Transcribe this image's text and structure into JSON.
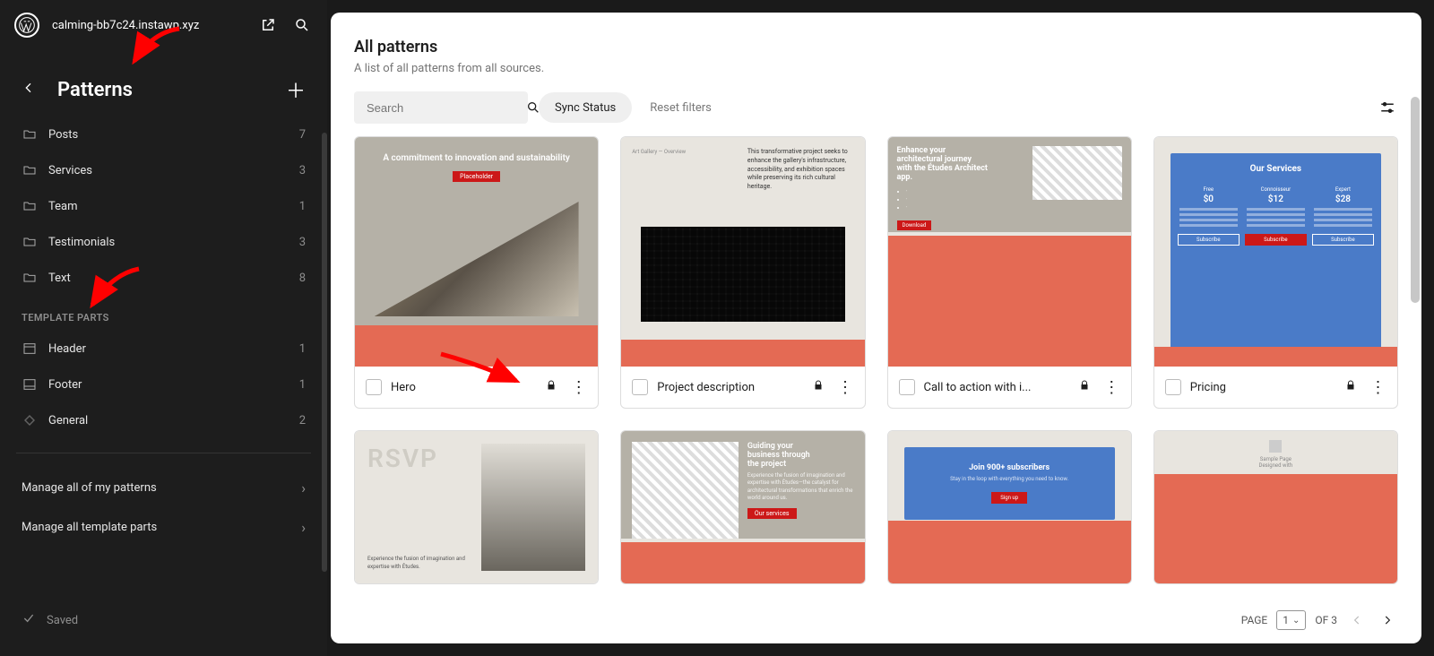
{
  "site": {
    "name": "calming-bb7c24.instawp.xyz"
  },
  "sidebar": {
    "title": "Patterns",
    "categories": [
      {
        "label": "Posts",
        "count": "7"
      },
      {
        "label": "Services",
        "count": "3"
      },
      {
        "label": "Team",
        "count": "1"
      },
      {
        "label": "Testimonials",
        "count": "3"
      },
      {
        "label": "Text",
        "count": "8"
      }
    ],
    "template_parts_heading": "TEMPLATE PARTS",
    "template_parts": [
      {
        "label": "Header",
        "count": "1"
      },
      {
        "label": "Footer",
        "count": "1"
      },
      {
        "label": "General",
        "count": "2"
      }
    ],
    "manage_patterns": "Manage all of my patterns",
    "manage_parts": "Manage all template parts",
    "saved": "Saved"
  },
  "panel": {
    "title": "All patterns",
    "subtitle": "A list of all patterns from all sources.",
    "search_placeholder": "Search",
    "sync_status": "Sync Status",
    "reset": "Reset filters"
  },
  "cards": [
    {
      "title": "Hero"
    },
    {
      "title": "Project description"
    },
    {
      "title": "Call to action with i..."
    },
    {
      "title": "Pricing"
    }
  ],
  "preview_strings": {
    "hero_h": "A commitment to innovation and sustainability",
    "hero_btn": "Placeholder",
    "proj_small": "Art Gallery — Overview",
    "proj_body": "This transformative project seeks to enhance the gallery's infrastructure, accessibility, and exhibition spaces while preserving its rich cultural heritage.",
    "cta_h1": "Enhance your",
    "cta_h2": "architectural journey",
    "cta_h3": "with the Études Architect",
    "cta_h4": "app.",
    "pricing_h": "Our Services",
    "price_a_name": "Free",
    "price_a": "$0",
    "price_b_name": "Connoisseur",
    "price_b": "$12",
    "price_c_name": "Expert",
    "price_c": "$28",
    "rsvp": "RSVP",
    "guide_h1": "Guiding your",
    "guide_h2": "business through",
    "guide_h3": "the project",
    "sub_h": "Join 900+ subscribers",
    "sub_p": "Stay in the loop with everything you need to know.",
    "sub_btn": "Sign up",
    "mini_t": "Sample Page",
    "mini_s": "Designed with"
  },
  "pagination": {
    "page_label": "PAGE",
    "current": "1",
    "of_label": "OF 3"
  }
}
